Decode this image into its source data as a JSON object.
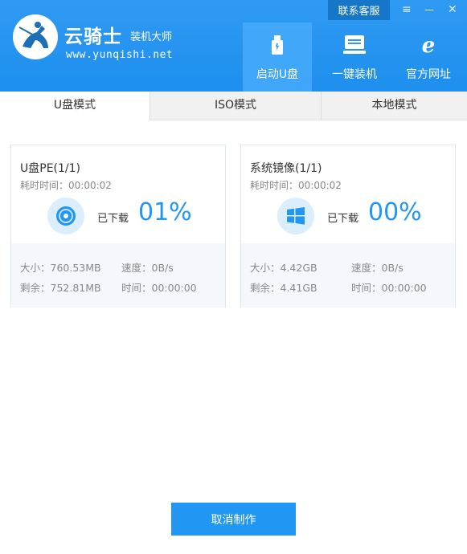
{
  "header": {
    "brand_name": "云骑士",
    "brand_suffix": "装机大师",
    "url": "www.yunqishi.net",
    "contact_label": "联系客服",
    "window_controls": {
      "menu": "≡",
      "minimize": "—",
      "close": "✕"
    },
    "nav": [
      {
        "label": "启动U盘",
        "icon": "usb-drive-icon",
        "active": true
      },
      {
        "label": "一键装机",
        "icon": "computer-icon",
        "active": false
      },
      {
        "label": "官方网址",
        "icon": "ie-browser-icon",
        "active": false
      }
    ],
    "colors": {
      "primary": "#2196f3",
      "header_bg": "#2f9af2",
      "contact_bg": "#1677c9"
    }
  },
  "tabs": [
    {
      "label": "U盘模式",
      "active": true
    },
    {
      "label": "ISO模式",
      "active": false
    },
    {
      "label": "本地模式",
      "active": false
    }
  ],
  "cards": [
    {
      "title": "U盘PE(1/1)",
      "elapsed": "耗时时间：00:00:02",
      "icon": "disc-icon",
      "downloaded_label": "已下载",
      "percent": "01%",
      "size": "大小：760.53MB",
      "speed": "速度：0B/s",
      "remaining": "剩余：752.81MB",
      "time": "时间：00:00:00"
    },
    {
      "title": "系统镜像(1/1)",
      "elapsed": "耗时时间：00:00:02",
      "icon": "windows-icon",
      "downloaded_label": "已下载",
      "percent": "00%",
      "size": "大小：4.42GB",
      "speed": "速度：0B/s",
      "remaining": "剩余：4.41GB",
      "time": "时间：00:00:00"
    }
  ],
  "footer": {
    "cancel_label": "取消制作"
  }
}
